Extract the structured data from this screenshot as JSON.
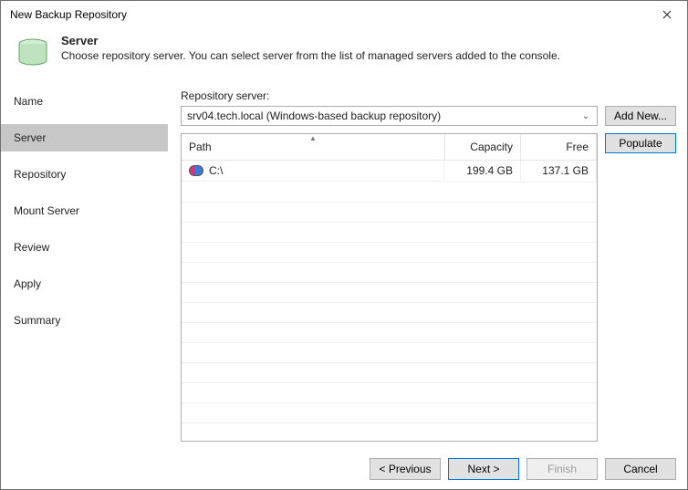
{
  "window": {
    "title": "New Backup Repository"
  },
  "header": {
    "heading": "Server",
    "subheading": "Choose repository server. You can select server from the list of managed servers added to the console."
  },
  "nav": {
    "items": [
      {
        "label": "Name"
      },
      {
        "label": "Server"
      },
      {
        "label": "Repository"
      },
      {
        "label": "Mount Server"
      },
      {
        "label": "Review"
      },
      {
        "label": "Apply"
      },
      {
        "label": "Summary"
      }
    ],
    "selected_index": 1
  },
  "content": {
    "repo_server_label": "Repository server:",
    "dropdown_value": "srv04.tech.local (Windows-based backup repository)",
    "add_new_label": "Add New...",
    "populate_label": "Populate",
    "columns": {
      "path": "Path",
      "capacity": "Capacity",
      "free": "Free"
    },
    "rows": [
      {
        "path": "C:\\",
        "capacity": "199.4 GB",
        "free": "137.1 GB"
      }
    ]
  },
  "footer": {
    "previous": "< Previous",
    "next": "Next >",
    "finish": "Finish",
    "cancel": "Cancel"
  }
}
